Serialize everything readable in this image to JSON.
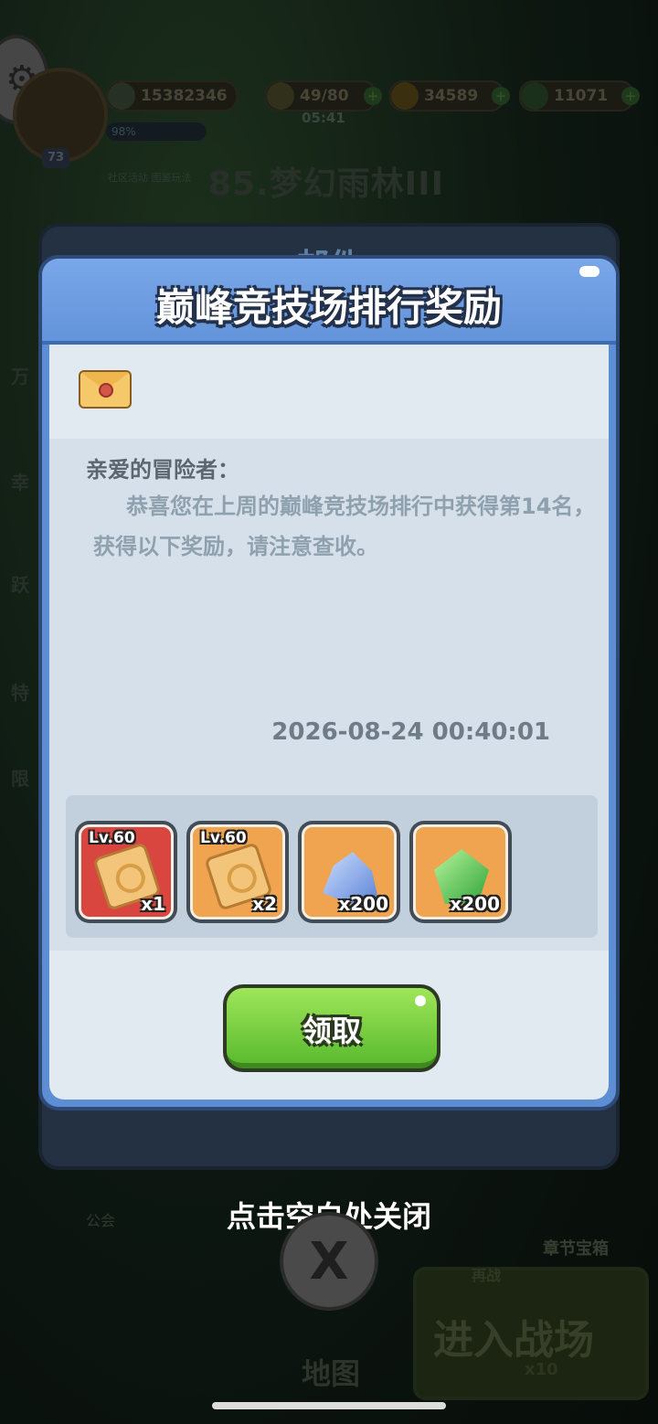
{
  "hud": {
    "power": "15382346",
    "xp_percent": "98%",
    "player_level": "73",
    "stamina": "49/80",
    "stamina_timer": "05:41",
    "gold": "34589",
    "gems": "11071",
    "links": "社区活动  图鉴玩法",
    "stage_title": "85.梦幻雨林III"
  },
  "background": {
    "side_labels": [
      "万",
      "幸",
      "跃",
      "特",
      "限"
    ],
    "back_panel_title": "邮件",
    "guild_label": "公会",
    "chest_label": "章节宝箱",
    "map_label": "地图",
    "battle_button": {
      "label": "进入战场",
      "tag": "再战",
      "cost": "x10"
    }
  },
  "dialog": {
    "title": "巅峰竞技场排行奖励",
    "greeting": "亲爱的冒险者：",
    "message": "恭喜您在上周的巅峰竞技场排行中获得第14名，获得以下奖励，请注意查收。",
    "date": "2026-08-24 00:40:01",
    "rewards": [
      {
        "level": "Lv.60",
        "quantity": "x1",
        "icon": "scroll-icon",
        "bg": "#d9463f"
      },
      {
        "level": "Lv.60",
        "quantity": "x2",
        "icon": "scroll-icon",
        "bg": "#f0a44f"
      },
      {
        "level": "",
        "quantity": "x200",
        "icon": "crystal-ore-icon",
        "bg": "#f0a44f"
      },
      {
        "level": "",
        "quantity": "x200",
        "icon": "green-gem-icon",
        "bg": "#f0a44f"
      }
    ],
    "claim_label": "领取"
  },
  "overlay": {
    "hint": "点击空白处关闭",
    "close_glyph": "X"
  },
  "colors": {
    "header": "#6e9ee2",
    "claim": "#7fd545"
  }
}
